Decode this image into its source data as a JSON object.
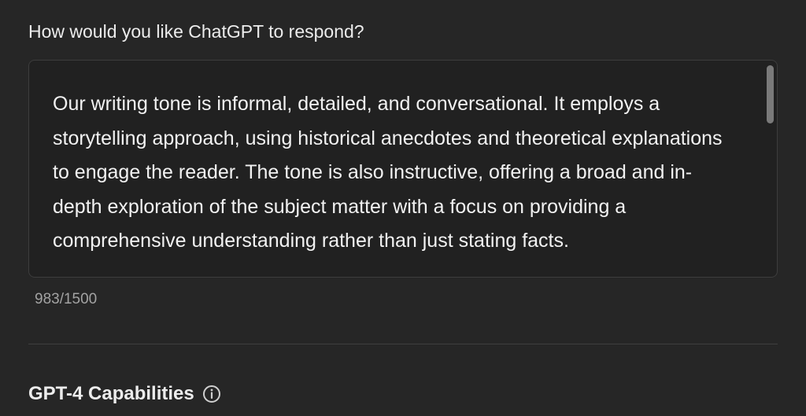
{
  "question": {
    "label": "How would you like ChatGPT to respond?"
  },
  "response_field": {
    "value": "Our writing tone is informal, detailed, and conversational. It employs a storytelling approach, using historical anecdotes and theoretical explanations to engage the reader. The tone is also instructive, offering a broad and in-depth exploration of the subject matter with a focus on providing a comprehensive understanding rather than just stating facts.",
    "character_count": "983/1500"
  },
  "capabilities": {
    "title": "GPT-4 Capabilities",
    "icon": "info-icon"
  },
  "colors": {
    "background": "#262626",
    "field_background": "#212121",
    "border": "#3d3d3d",
    "text": "#ececec",
    "muted_text": "#a3a3a3"
  }
}
